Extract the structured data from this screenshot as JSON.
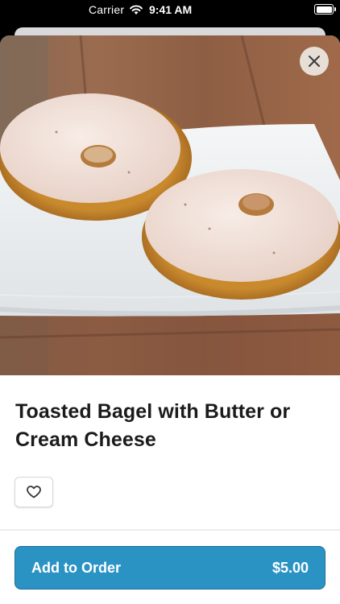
{
  "status_bar": {
    "carrier": "Carrier",
    "time": "9:41 AM"
  },
  "item": {
    "title": "Toasted Bagel with Butter or Cream Cheese",
    "image_icon": "bagel-photo"
  },
  "actions": {
    "close_icon": "close-icon",
    "favorite_icon": "heart-icon",
    "add_label": "Add to Order",
    "price": "$5.00"
  },
  "colors": {
    "accent": "#2a93c3",
    "accent_border": "#1d6f95",
    "text": "#1b1b1d"
  }
}
